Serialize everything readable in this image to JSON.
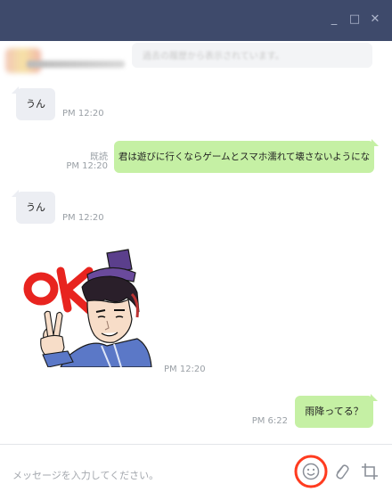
{
  "window": {
    "controls": {
      "minimize": "_",
      "maximize": "□",
      "close": "✕"
    }
  },
  "chat": {
    "notice_text": "過去の履歴から表示されています。",
    "messages": [
      {
        "direction": "in",
        "text": "うん",
        "time": "PM 12:20"
      },
      {
        "direction": "out",
        "text": "君は遊びに行くならゲームとスマホ濡れて壊さないようにな",
        "read": "既読",
        "time": "PM 12:20"
      },
      {
        "direction": "in",
        "text": "うん",
        "time": "PM 12:20"
      },
      {
        "direction": "in",
        "sticker": "ok-sticker",
        "time": "PM 12:20"
      },
      {
        "direction": "out",
        "text": "雨降ってる？",
        "time": "PM 6:22"
      }
    ]
  },
  "input": {
    "placeholder": "メッセージを入力してください。"
  },
  "icons": {
    "emoji": "smiley-icon",
    "attach": "paperclip-icon",
    "crop": "crop-icon"
  },
  "colors": {
    "titlebar": "#3e4a6b",
    "bubble_out": "#c5f0a4",
    "bubble_in": "#eceef3",
    "highlight": "#ff3b1f"
  }
}
